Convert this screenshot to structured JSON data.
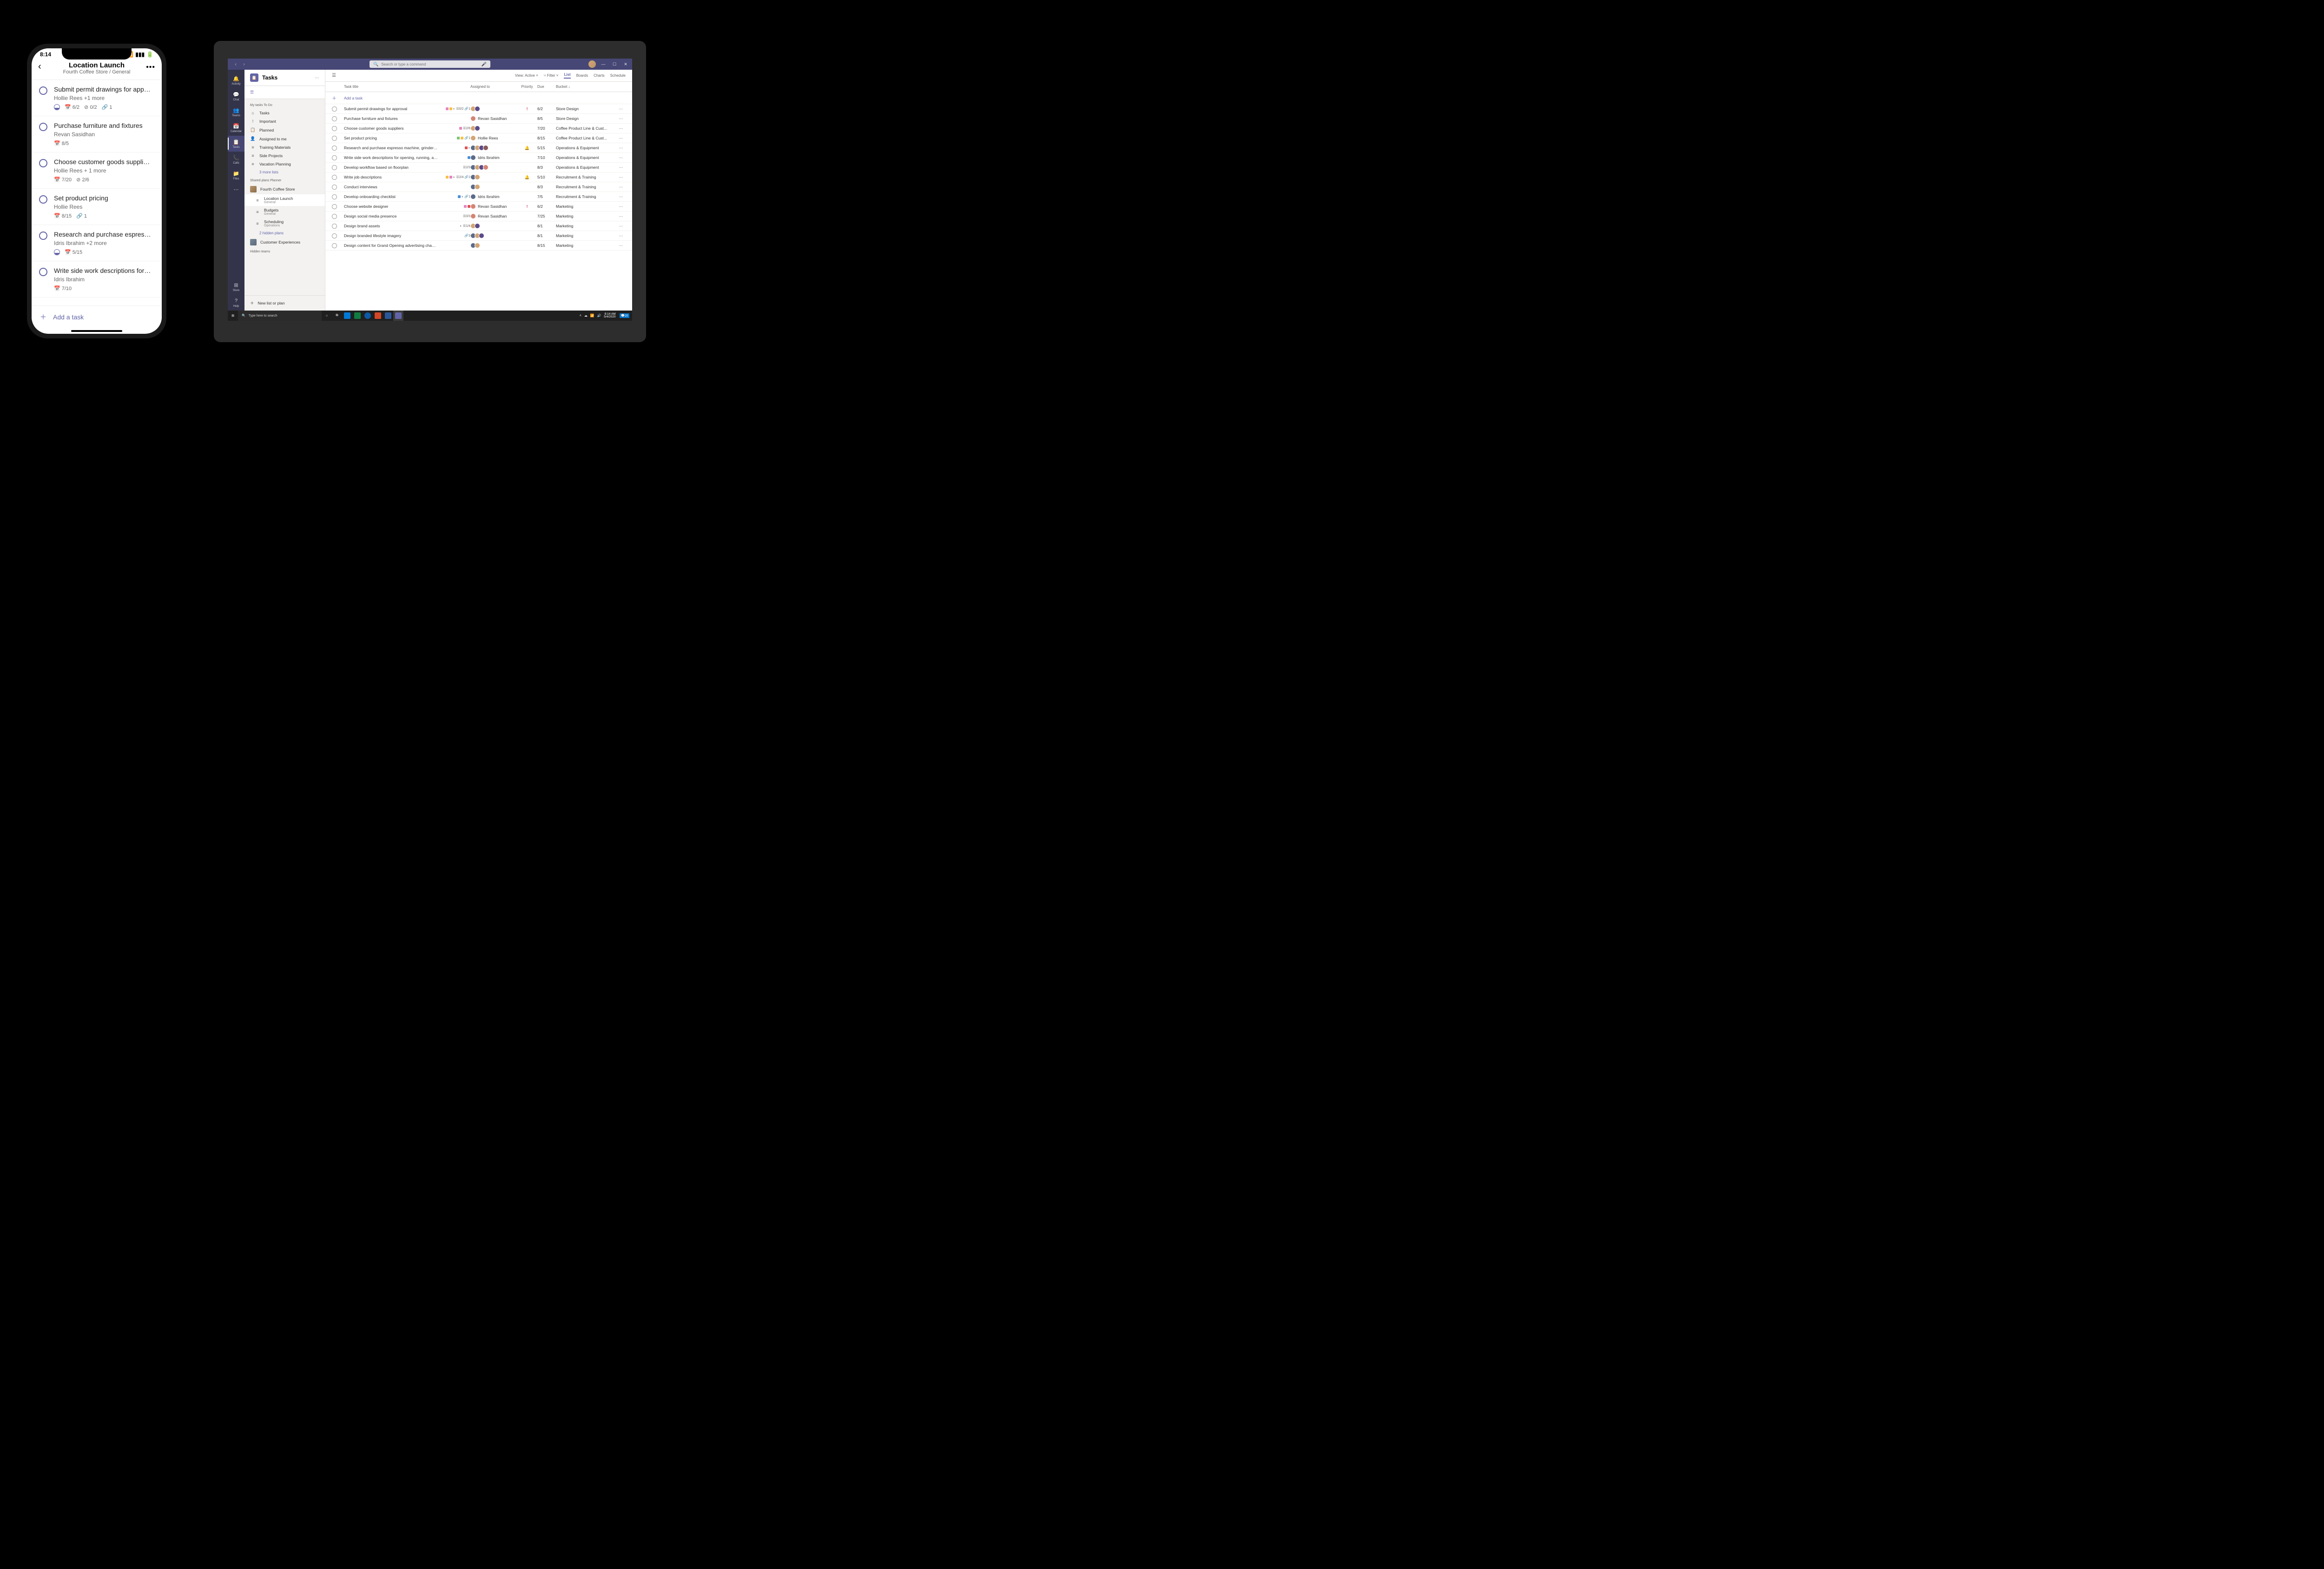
{
  "phone": {
    "time": "8:14",
    "title": "Location Launch",
    "subtitle": "Fourth Coffee Store / General",
    "addTask": "Add a task",
    "tasks": [
      {
        "title": "Submit permit drawings for approval",
        "assignee": "Hollie Rees +1 more",
        "progress": true,
        "date": "6/2",
        "check": "0/2",
        "attach": "1"
      },
      {
        "title": "Purchase furniture and fixtures",
        "assignee": "Revan Sasidhan",
        "date": "8/5"
      },
      {
        "title": "Choose customer goods suppliers",
        "assignee": "Hollie Rees + 1 more",
        "date": "7/20",
        "check": "2/6"
      },
      {
        "title": "Set product pricing",
        "assignee": "Hollie Rees",
        "date": "8/15",
        "attach": "1"
      },
      {
        "title": "Research and purchase espresso...",
        "assignee": "Idris Ibrahim +2 more",
        "progress": true,
        "date": "5/15"
      },
      {
        "title": "Write side work descriptions for op...",
        "assignee": "Idris Ibrahim",
        "date": "7/10"
      }
    ]
  },
  "teams": {
    "searchPlaceholder": "Search or type a command",
    "rail": [
      {
        "icon": "🔔",
        "label": "Activity"
      },
      {
        "icon": "💬",
        "label": "Chat"
      },
      {
        "icon": "👥",
        "label": "Teams"
      },
      {
        "icon": "📅",
        "label": "Calendar"
      },
      {
        "icon": "📋",
        "label": "Tasks",
        "active": true
      },
      {
        "icon": "📞",
        "label": "Calls"
      },
      {
        "icon": "📁",
        "label": "Files"
      }
    ],
    "railBottom": [
      {
        "icon": "⊞",
        "label": "Store"
      },
      {
        "icon": "?",
        "label": "Help"
      }
    ],
    "panel": {
      "title": "Tasks",
      "myTasksTitle": "My tasks  To Do",
      "myTasks": [
        {
          "icon": "⌂",
          "label": "Tasks"
        },
        {
          "icon": "!",
          "label": "Important"
        },
        {
          "icon": "📋",
          "label": "Planned"
        },
        {
          "icon": "👤",
          "label": "Assigned to me"
        },
        {
          "icon": "≡",
          "label": "Training Materials"
        },
        {
          "icon": "≡",
          "label": "Side Projects"
        },
        {
          "icon": "≡",
          "label": "Vacation Planning"
        }
      ],
      "moreLists": "3 more lists",
      "sharedTitle": "Shared plans  Planner",
      "team1": "Fourth Coffee Store",
      "team1Plans": [
        {
          "label": "Location Launch",
          "sub": "General",
          "active": true
        },
        {
          "label": "Budgets",
          "sub": "General"
        },
        {
          "label": "Scheduling",
          "sub": "Operations"
        }
      ],
      "hiddenPlans": "2 hidden plans",
      "team2": "Customer Experiences",
      "hiddenTeams": "Hidden teams",
      "newList": "New list or plan"
    },
    "toolbar": {
      "view": "View: Active",
      "filter": "Filter",
      "tabs": [
        "List",
        "Boards",
        "Charts",
        "Schedule"
      ]
    },
    "columns": {
      "title": "Task title",
      "assigned": "Assigned to",
      "priority": "Priority",
      "due": "Due",
      "bucket": "Bucket ↓"
    },
    "addTask": "Add a task",
    "rows": [
      {
        "title": "Submit permit drawings for approval",
        "indicators": {
          "boxes": [
            "#e684c4",
            "#f5c242"
          ],
          "progress": true,
          "check": "0/2",
          "attach": "1"
        },
        "avatars": [
          "#d4a574",
          "#5b4a8a"
        ],
        "priority": "!",
        "due": "6/2",
        "bucket": "Store Design"
      },
      {
        "title": "Purchase furniture and fixtures",
        "avatars": [
          "#d48574"
        ],
        "assignee": "Revan Sasidhan",
        "due": "8/5",
        "bucket": "Store Design"
      },
      {
        "title": "Choose customer goods suppliers",
        "indicators": {
          "boxes": [
            "#e684c4"
          ],
          "check": "2/6"
        },
        "avatars": [
          "#d4a574",
          "#5b4a8a"
        ],
        "due": "7/20",
        "bucket": "Coffee Product Line & Cust..."
      },
      {
        "title": "Set product pricing",
        "indicators": {
          "boxes": [
            "#7cc576",
            "#f5c242"
          ],
          "attach": "1"
        },
        "avatars": [
          "#d4a574"
        ],
        "assignee": "Hollie Rees",
        "due": "8/15",
        "bucket": "Coffee Product Line & Cust..."
      },
      {
        "title": "Research and purchase espresso machine, grinders, and roaster",
        "indicators": {
          "boxes": [
            "#e05252"
          ],
          "progress": true
        },
        "avatars": [
          "#5b6b8a",
          "#d4a574",
          "#5b4a8a",
          "#8a5b5b"
        ],
        "priority": "🔔",
        "due": "5/15",
        "bucket": "Operations & Equipment"
      },
      {
        "title": "Write side work descriptions for opening, running, and closing",
        "indicators": {
          "boxes": [
            "#4a90d9"
          ]
        },
        "avatars": [
          "#5b6b8a"
        ],
        "assignee": "Idris Ibrahim",
        "due": "7/10",
        "bucket": "Operations & Equipment"
      },
      {
        "title": "Develop workflow based on floorplan",
        "indicators": {
          "check": "2/3"
        },
        "avatars": [
          "#5b6b8a",
          "#d4a574",
          "#5b4a8a",
          "#d48574"
        ],
        "due": "8/3",
        "bucket": "Operations & Equipment"
      },
      {
        "title": "Write job descriptions",
        "indicators": {
          "boxes": [
            "#f5c242",
            "#e684c4"
          ],
          "progress": true,
          "check": "2/4",
          "attach": "2"
        },
        "avatars": [
          "#5b6b8a",
          "#d4a574"
        ],
        "priority": "🔔",
        "due": "5/10",
        "bucket": "Recruitment & Training"
      },
      {
        "title": "Conduct interviews",
        "avatars": [
          "#5b6b8a",
          "#d4a574"
        ],
        "due": "8/3",
        "bucket": "Recruitment & Training"
      },
      {
        "title": "Develop onboarding checklist",
        "indicators": {
          "boxes": [
            "#4a90d9"
          ],
          "progress": true,
          "attach": "1"
        },
        "avatars": [
          "#5b6b8a"
        ],
        "assignee": "Idris Ibrahim",
        "due": "7/5",
        "bucket": "Recruitment & Training"
      },
      {
        "title": "Choose website designer",
        "indicators": {
          "boxes": [
            "#e684c4",
            "#e05252"
          ]
        },
        "avatars": [
          "#d48574"
        ],
        "assignee": "Revan Sasidhan",
        "priority": "!",
        "due": "6/2",
        "bucket": "Marketing"
      },
      {
        "title": "Design social media presence",
        "indicators": {
          "check": "0/3"
        },
        "avatars": [
          "#d48574"
        ],
        "assignee": "Revan Sasidhan",
        "due": "7/25",
        "bucket": "Marketing"
      },
      {
        "title": "Design brand assets",
        "indicators": {
          "progress": true,
          "check": "1/4"
        },
        "avatars": [
          "#d4a574",
          "#5b4a8a"
        ],
        "due": "8/1",
        "bucket": "Marketing"
      },
      {
        "title": "Design branded lifestyle imagery",
        "indicators": {
          "attach": "3"
        },
        "avatars": [
          "#5b6b8a",
          "#d4a574",
          "#5b4a8a"
        ],
        "due": "8/1",
        "bucket": "Marketing"
      },
      {
        "title": "Design content for Grand Opening advertising channels",
        "avatars": [
          "#5b6b8a",
          "#d4a574"
        ],
        "due": "8/15",
        "bucket": "Marketing"
      }
    ]
  },
  "taskbar": {
    "search": "Type here to search",
    "time": "8:14 AM",
    "date": "5/4/2020",
    "badge": "20"
  }
}
